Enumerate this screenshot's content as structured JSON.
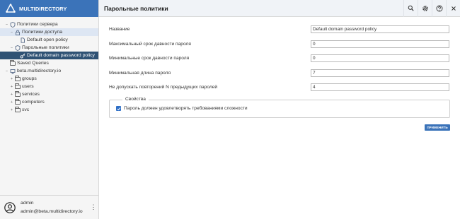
{
  "app": {
    "brand": "MULTIDIRECTORY"
  },
  "sidebar": {
    "tree": [
      {
        "label": "Политики сервера",
        "toggle": "−"
      },
      {
        "label": "Политики доступа",
        "toggle": "−"
      },
      {
        "label": "Default open policy"
      },
      {
        "label": "Парольные политики",
        "toggle": "−"
      },
      {
        "label": "Default domain password policy"
      },
      {
        "label": "Saved Queries"
      },
      {
        "label": "beta.multidirectory.io",
        "toggle": "−"
      },
      {
        "label": "groups",
        "toggle": "+"
      },
      {
        "label": "users",
        "toggle": "+"
      },
      {
        "label": "services",
        "toggle": "+"
      },
      {
        "label": "computers",
        "toggle": "+"
      },
      {
        "label": "svc",
        "toggle": "+"
      }
    ],
    "user": {
      "name": "admin",
      "email": "admin@beta.multidirectory.io",
      "menu": "⋮"
    }
  },
  "header": {
    "title": "Парольные политики",
    "buttons": [
      "search-icon",
      "gear-icon",
      "help-icon",
      "close-icon"
    ]
  },
  "form": {
    "fields": [
      {
        "label": "Название",
        "value": "Default domain password policy"
      },
      {
        "label": "Максимальный срок давности пароля",
        "value": "0"
      },
      {
        "label": "Минимальные срок давности пароля",
        "value": "0"
      },
      {
        "label": "Минимальная длина пароля",
        "value": "7"
      },
      {
        "label": "Не допускать повторений N предыдущих паролей",
        "value": "4"
      }
    ],
    "properties": {
      "legend": "Свойства",
      "complexity_label": "Пароль должен удовлетворять требованиями сложности",
      "complexity_checked": true
    },
    "apply_label": "ПРИМЕНИТЬ"
  },
  "colors": {
    "brand": "#3b73b9",
    "selected": "#2f5274",
    "highlight": "#dde6f3"
  }
}
